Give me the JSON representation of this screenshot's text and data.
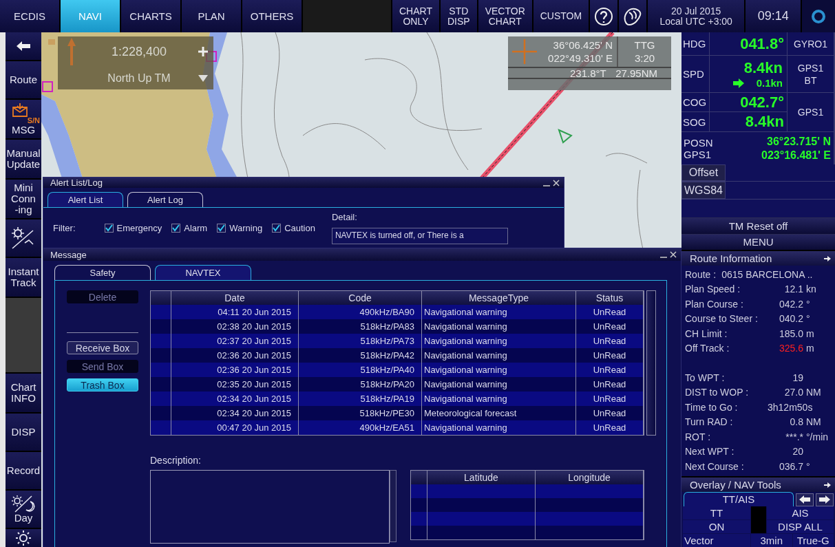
{
  "top_bar": {
    "tabs": [
      {
        "label": "ECDIS",
        "selected": false
      },
      {
        "label": "NAVI",
        "selected": true
      },
      {
        "label": "CHARTS",
        "selected": false
      },
      {
        "label": "PLAN",
        "selected": false
      },
      {
        "label": "OTHERS",
        "selected": false
      }
    ],
    "display_buttons": [
      {
        "lines": [
          "CHART",
          "ONLY"
        ]
      },
      {
        "lines": [
          "STD",
          "DISP"
        ]
      },
      {
        "lines": [
          "VECTOR",
          "CHART"
        ]
      },
      {
        "lines": [
          "CUSTOM"
        ]
      }
    ],
    "date": "20 Jul 2015",
    "timezone": "Local UTC +3:00",
    "time": "09:14"
  },
  "sidebar": {
    "items": [
      {
        "kind": "back"
      },
      {
        "kind": "text",
        "lines": [
          "Route"
        ]
      },
      {
        "kind": "msg",
        "lines": [
          "MSG"
        ],
        "badge": "S/N"
      },
      {
        "kind": "text",
        "lines": [
          "Manual",
          "Update"
        ]
      },
      {
        "kind": "text",
        "lines": [
          "Mini",
          "Conn",
          "-ing"
        ]
      },
      {
        "kind": "tools"
      },
      {
        "kind": "text",
        "lines": [
          "Instant",
          "Track"
        ]
      },
      {
        "kind": "preview"
      },
      {
        "kind": "text",
        "lines": [
          "Chart",
          "INFO"
        ]
      },
      {
        "kind": "text",
        "lines": [
          "DISP"
        ]
      },
      {
        "kind": "text",
        "lines": [
          "Record"
        ]
      },
      {
        "kind": "daynight",
        "lines": [
          "Day"
        ]
      },
      {
        "kind": "brightness"
      }
    ]
  },
  "chart": {
    "scale_box": {
      "scale": "1:228,400",
      "orientation": "North  Up TM"
    },
    "cursor_box": {
      "latitude": "36°06.425' N",
      "longitude": "022°49.310' E",
      "ttg_label": "TTG",
      "ttg": "3:20",
      "bearing": "231.8°T",
      "distance": "27.95NM"
    }
  },
  "alert_window": {
    "title": "Alert List/Log",
    "tabs": [
      {
        "label": "Alert List",
        "selected": true
      },
      {
        "label": "Alert Log",
        "selected": false
      }
    ],
    "filter_label": "Filter:",
    "filters": [
      {
        "label": "Emergency",
        "checked": true
      },
      {
        "label": "Alarm",
        "checked": true
      },
      {
        "label": "Warning",
        "checked": true
      },
      {
        "label": "Caution",
        "checked": true
      }
    ],
    "detail_label": "Detail:",
    "detail_text": "NAVTEX is turned off, or There is a"
  },
  "message_window": {
    "title": "Message",
    "tabs": [
      {
        "label": "Safety",
        "selected": false
      },
      {
        "label": "NAVTEX",
        "selected": true
      }
    ],
    "buttons": [
      {
        "label": "Delete",
        "disabled": true,
        "selected": false
      },
      {
        "label": "Receive Box",
        "disabled": false,
        "selected": false
      },
      {
        "label": "Send Box",
        "disabled": true,
        "selected": false
      },
      {
        "label": "Trash Box",
        "disabled": false,
        "selected": true
      }
    ],
    "columns": [
      "Date",
      "Code",
      "MessageType",
      "Status"
    ],
    "rows": [
      {
        "date": "04:11  20 Jun 2015",
        "code": "490kHz/BA90",
        "type": "Navigational warning",
        "status": "UnRead"
      },
      {
        "date": "02:38  20 Jun 2015",
        "code": "518kHz/PA83",
        "type": "Navigational warning",
        "status": "UnRead"
      },
      {
        "date": "02:37  20 Jun 2015",
        "code": "518kHz/PA73",
        "type": "Navigational warning",
        "status": "UnRead"
      },
      {
        "date": "02:36  20 Jun 2015",
        "code": "518kHz/PA42",
        "type": "Navigational warning",
        "status": "UnRead"
      },
      {
        "date": "02:36  20 Jun 2015",
        "code": "518kHz/PA40",
        "type": "Navigational warning",
        "status": "UnRead"
      },
      {
        "date": "02:35  20 Jun 2015",
        "code": "518kHz/PA20",
        "type": "Navigational warning",
        "status": "UnRead"
      },
      {
        "date": "02:34  20 Jun 2015",
        "code": "518kHz/PA19",
        "type": "Navigational warning",
        "status": "UnRead"
      },
      {
        "date": "02:34  20 Jun 2015",
        "code": "518kHz/PE30",
        "type": "Meteorological forecast",
        "status": "UnRead"
      },
      {
        "date": "00:47  20 Jun 2015",
        "code": "490kHz/EA51",
        "type": "Navigational warning",
        "status": "UnRead"
      }
    ],
    "description_label": "Description:",
    "position_columns": [
      "Latitude",
      "Longitude"
    ]
  },
  "nav_data": {
    "hdg": {
      "label": "HDG",
      "value": "041.8°",
      "source": "GYRO1"
    },
    "spd": {
      "label": "SPD",
      "value": "8.4kn",
      "drift": "0.1kn",
      "source": [
        "GPS1",
        "BT"
      ]
    },
    "cog": {
      "label": "COG",
      "value": "042.7°"
    },
    "sog": {
      "label": "SOG",
      "value": "8.4kn"
    },
    "course_source": "GPS1",
    "posn": {
      "labels": [
        "POSN",
        "GPS1"
      ],
      "latitude": "36°23.715' N",
      "longitude": "023°16.481' E"
    },
    "offset": "Offset",
    "datum": "WGS84",
    "tm_reset": "TM Reset off",
    "menu": "MENU"
  },
  "route_info": {
    "title": "Route Information",
    "groups": [
      [
        {
          "label": "Route :",
          "value": "0615 BARCELONA ..",
          "warning": false
        },
        {
          "label": "Plan Speed :",
          "value": "12.1",
          "unit": "kn",
          "warning": false
        },
        {
          "label": "Plan Course :",
          "value": "042.2",
          "unit": "°",
          "warning": false
        },
        {
          "label": "Course to Steer :",
          "value": "040.2",
          "unit": "°",
          "warning": false
        },
        {
          "label": "CH Limit :",
          "value": "185.0",
          "unit": "m",
          "warning": false
        },
        {
          "label": "Off Track :",
          "value": "325.6",
          "unit": "m",
          "warning": true
        }
      ],
      [
        {
          "label": "To WPT :",
          "value": "19",
          "warning": false
        },
        {
          "label": "DIST to WOP :",
          "value": "27.0",
          "unit": "NM",
          "warning": false
        },
        {
          "label": "Time to Go :",
          "value": "3h12m50s",
          "warning": false
        },
        {
          "label": "Turn RAD :",
          "value": "0.8",
          "unit": "NM",
          "warning": false
        },
        {
          "label": "ROT :",
          "value": "***.*",
          "unit": "°/min",
          "warning": false
        },
        {
          "label": "Next WPT :",
          "value": "20",
          "warning": false
        },
        {
          "label": "Next Course :",
          "value": "036.7",
          "unit": "°",
          "warning": false
        }
      ]
    ]
  },
  "overlay_tools": {
    "title": "Overlay / NAV Tools",
    "tab": "TT/AIS",
    "tt": "TT",
    "ais": "AIS",
    "tt_state": "ON",
    "ais_state": "DISP ALL",
    "vector_label": "Vector",
    "vector_time": "3min",
    "vector_mode": "True-G"
  }
}
